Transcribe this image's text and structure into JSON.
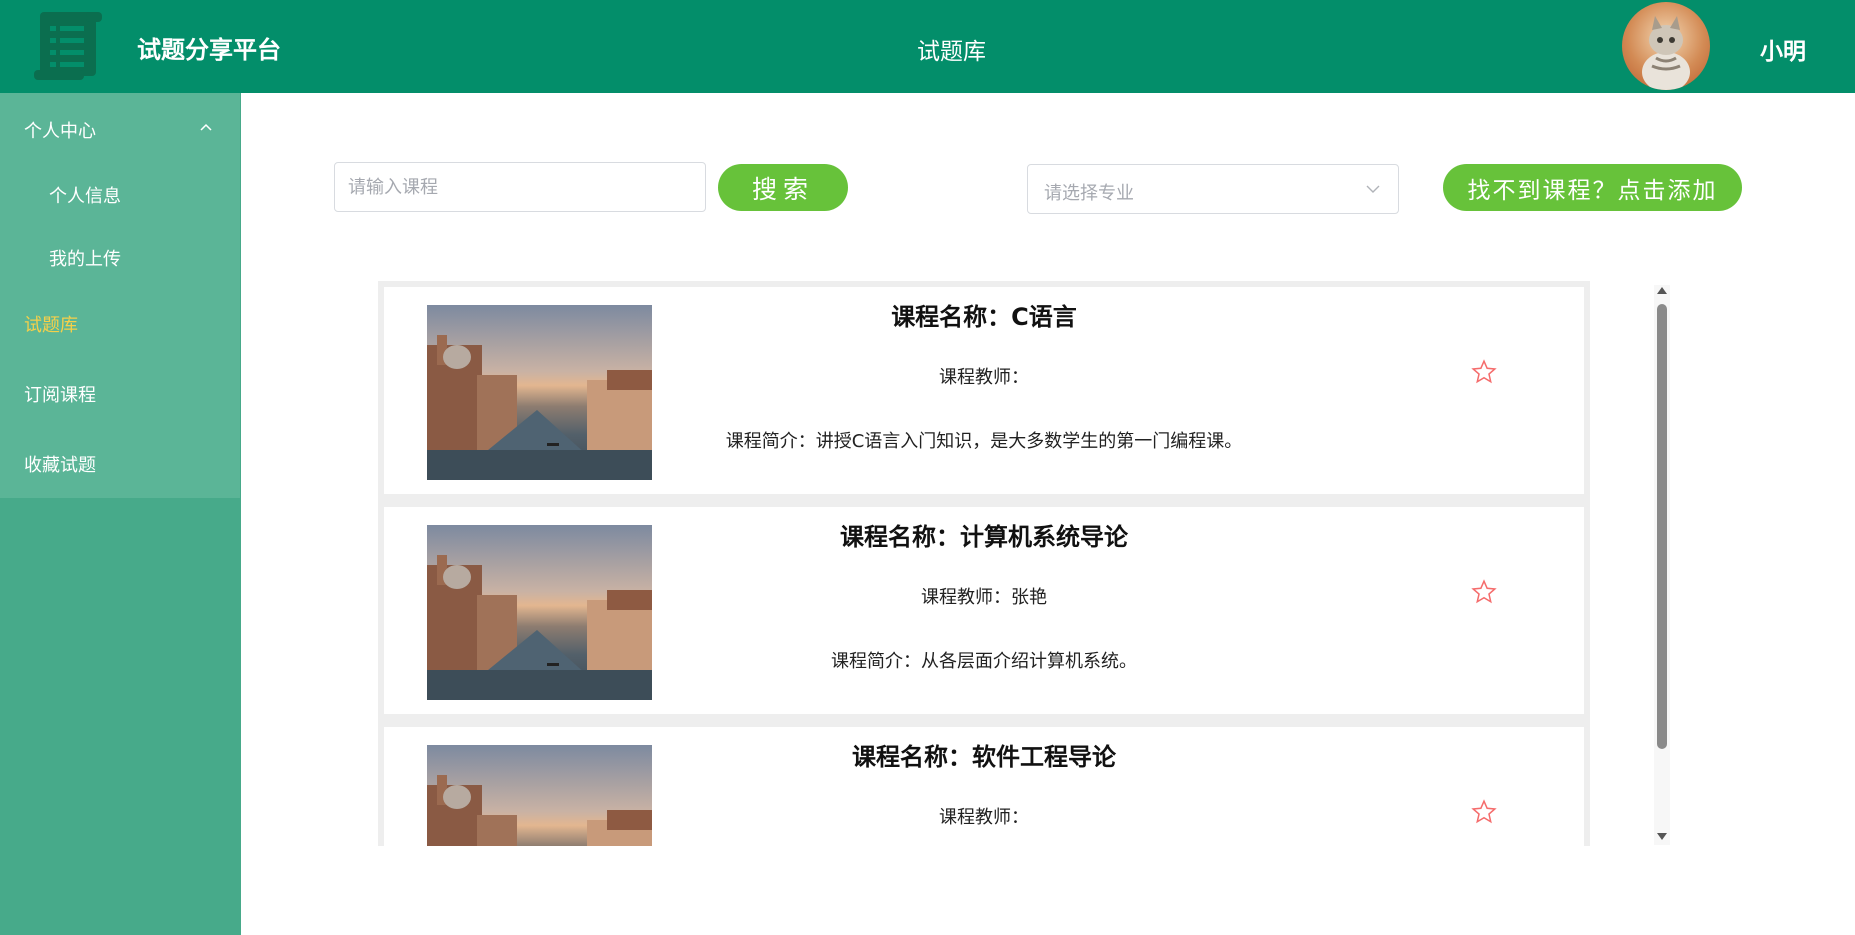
{
  "header": {
    "brand": "试题分享平台",
    "title": "试题库",
    "username": "小明"
  },
  "sidebar": {
    "group_label": "个人中心",
    "group_items": [
      {
        "label": "个人信息"
      },
      {
        "label": "我的上传"
      }
    ],
    "items": [
      {
        "label": "试题库",
        "active": true
      },
      {
        "label": "订阅课程"
      },
      {
        "label": "收藏试题"
      }
    ]
  },
  "search": {
    "placeholder": "请输入课程",
    "value": "",
    "button_label": "搜索",
    "major_placeholder": "请选择专业",
    "add_button_label": "找不到课程？点击添加"
  },
  "courses": [
    {
      "name": "课程名称：C语言",
      "teacher": "课程教师：",
      "intro": "课程简介：讲授C语言入门知识，是大多数学生的第一门编程课。"
    },
    {
      "name": "课程名称：计算机系统导论",
      "teacher": "课程教师：张艳",
      "intro": "课程简介：从各层面介绍计算机系统。"
    },
    {
      "name": "课程名称：软件工程导论",
      "teacher": "课程教师：",
      "intro": ""
    }
  ],
  "colors": {
    "header_bg": "#038e6a",
    "sidebar_bg": "#47aa8a",
    "sidebar_menu_bg": "#5bb597",
    "active_menu": "#f5d04a",
    "button_green": "#67c23a",
    "star": "#f56c6c"
  },
  "icons": {
    "logo": "scroll-document-icon",
    "group_chevron": "chevron-up-icon",
    "select_arrow": "chevron-down-icon",
    "favorite": "star-outline-icon"
  }
}
